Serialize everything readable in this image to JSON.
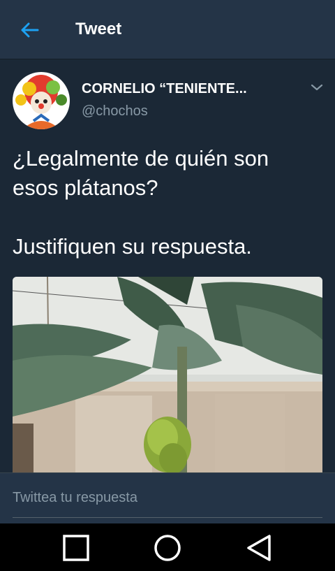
{
  "header": {
    "title": "Tweet",
    "back_icon": "arrow-left-icon"
  },
  "tweet": {
    "author_name": "CORNELIO “TENIENTE...",
    "author_handle": "@chochos",
    "text": "¿Legalmente de quién son\nesos plátanos?\n\nJustifiquen su respuesta.",
    "menu_icon": "chevron-down-icon"
  },
  "reply": {
    "placeholder": "Twittea tu respuesta"
  },
  "navbar": {
    "icons": [
      "square-icon",
      "circle-icon",
      "triangle-back-icon"
    ]
  },
  "colors": {
    "accent": "#1da1f2",
    "background": "#1b2836",
    "header": "#243447",
    "secondary_text": "#8899a6"
  }
}
